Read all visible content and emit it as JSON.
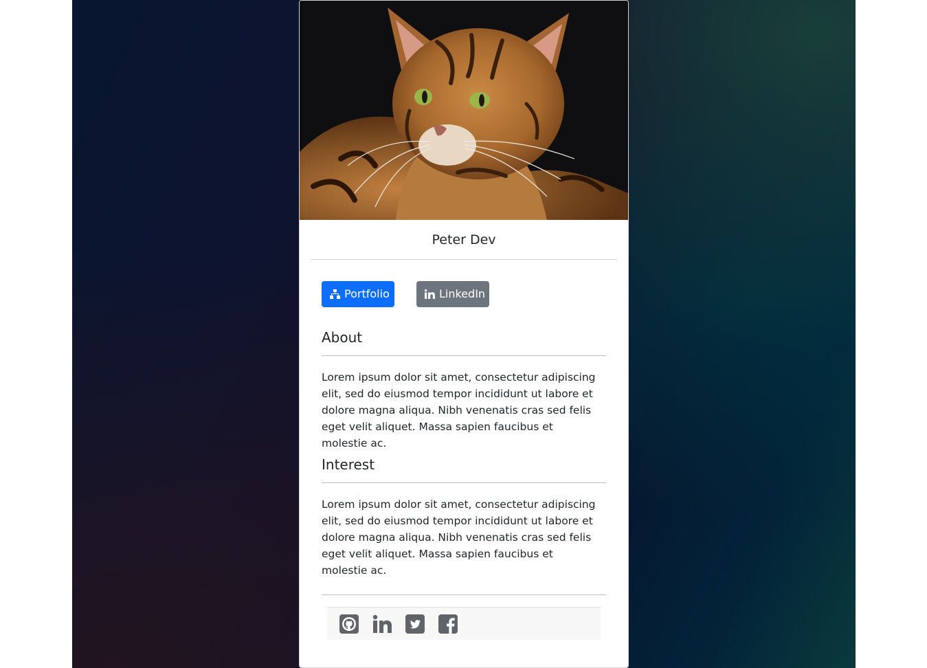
{
  "profile": {
    "name": "Peter Dev",
    "photo_icon": "cat-photo"
  },
  "buttons": {
    "portfolio": {
      "label": "Portfolio",
      "icon": "sitemap-icon",
      "color": "#0d6efd"
    },
    "linkedin": {
      "label": "LinkedIn",
      "icon": "linkedin-icon",
      "color": "#6c757d"
    }
  },
  "about": {
    "title": "About",
    "text": "Lorem ipsum dolor sit amet, consectetur adipiscing elit, sed do eiusmod tempor incididunt ut labore et dolore magna aliqua. Nibh venenatis cras sed felis eget velit aliquet. Massa sapien faucibus et molestie ac."
  },
  "interest": {
    "title": "Interest",
    "text": "Lorem ipsum dolor sit amet, consectetur adipiscing elit, sed do eiusmod tempor incididunt ut labore et dolore magna aliqua. Nibh venenatis cras sed felis eget velit aliquet. Massa sapien faucibus et molestie ac."
  },
  "social": [
    {
      "icon": "github-square-icon"
    },
    {
      "icon": "linkedin-in-icon"
    },
    {
      "icon": "twitter-square-icon"
    },
    {
      "icon": "facebook-square-icon"
    }
  ],
  "colors": {
    "icon_gray": "#5f646a",
    "text": "#212529"
  }
}
